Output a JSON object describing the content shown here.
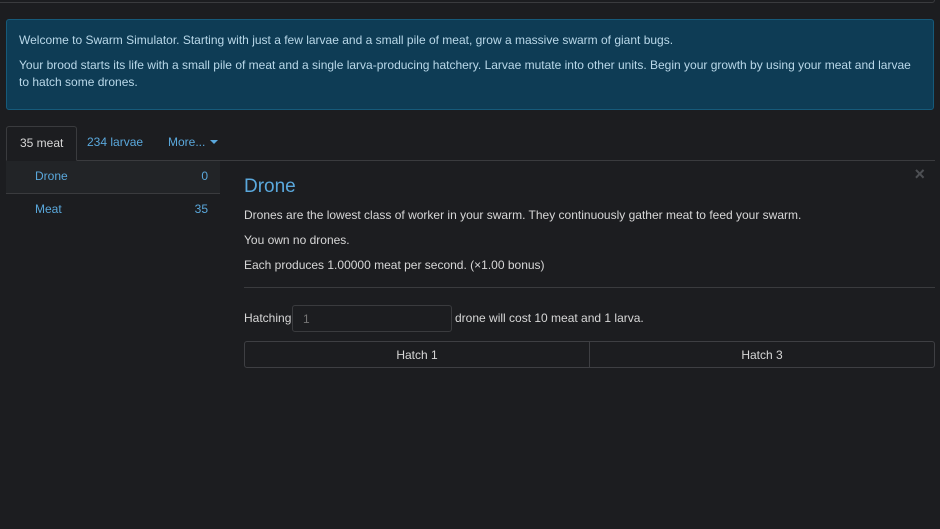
{
  "alert": {
    "line1": "Welcome to Swarm Simulator. Starting with just a few larvae and a small pile of meat, grow a massive swarm of giant bugs.",
    "line2": "Your brood starts its life with a small pile of meat and a single larva-producing hatchery. Larvae mutate into other units. Begin your growth by using your meat and larvae to hatch some drones."
  },
  "tabs": [
    {
      "label": "35 meat",
      "active": true
    },
    {
      "label": "234 larvae",
      "active": false
    },
    {
      "label": "More...",
      "active": false
    }
  ],
  "units": [
    {
      "name": "Drone",
      "count": "0",
      "active": true
    },
    {
      "name": "Meat",
      "count": "35",
      "active": false
    }
  ],
  "detail": {
    "close_glyph": "×",
    "title": "Drone",
    "description": "Drones are the lowest class of worker in your swarm. They continuously gather meat to feed your swarm.",
    "owned": "You own no drones.",
    "production": "Each produces 1.00000 meat per second. (×1.00 bonus)",
    "hatch_label": "Hatching",
    "hatch_placeholder": "1",
    "hatch_cost": "drone will cost 10 meat and 1 larva.",
    "buttons": [
      "Hatch 1",
      "Hatch 3"
    ]
  },
  "colors": {
    "accent": "#5aa8dc",
    "alert_bg": "#0e3c55",
    "page_bg": "#1c1d20"
  }
}
